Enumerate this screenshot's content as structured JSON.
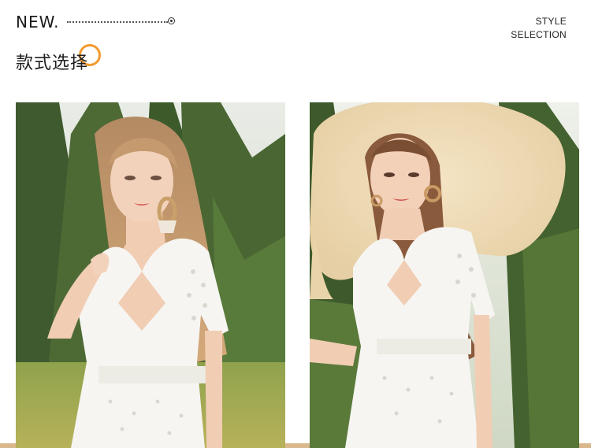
{
  "header": {
    "new_label": "NEW.",
    "style_line1": "STYLE",
    "style_line2": "SELECTION",
    "title": "款式选择"
  },
  "colors": {
    "accent_orange": "#f29a2e",
    "band_tan": "#d9b88d",
    "text_dark": "#1a1a1a"
  },
  "photos": [
    {
      "name": "model-left",
      "description_icon": "photo-icon"
    },
    {
      "name": "model-right-with-hat",
      "description_icon": "photo-icon"
    }
  ]
}
